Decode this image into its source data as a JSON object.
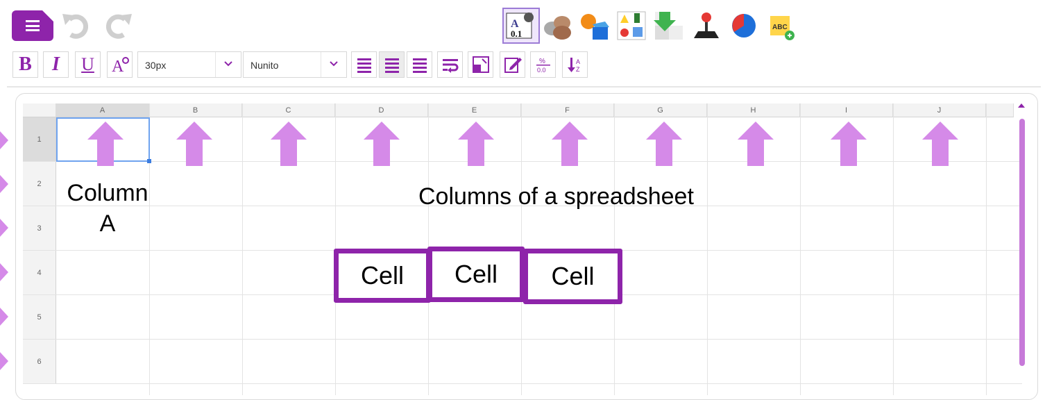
{
  "toolbar": {
    "menu_icon": "hamburger-menu-icon",
    "undo_icon": "undo-icon",
    "redo_icon": "redo-icon",
    "tools": [
      {
        "name": "number-format-tool-icon",
        "selected": true
      },
      {
        "name": "coins-tool-icon"
      },
      {
        "name": "shapes-tool-icon"
      },
      {
        "name": "sorting-chart-tool-icon"
      },
      {
        "name": "download-grid-tool-icon"
      },
      {
        "name": "joystick-tool-icon"
      },
      {
        "name": "pie-chart-tool-icon"
      },
      {
        "name": "add-text-tool-icon"
      }
    ]
  },
  "format_bar": {
    "bold": "B",
    "italic": "I",
    "underline": "U",
    "font_size": "30px",
    "font_family": "Nunito"
  },
  "sheet": {
    "columns": [
      "A",
      "B",
      "C",
      "D",
      "E",
      "F",
      "G",
      "H",
      "I",
      "J"
    ],
    "rows": [
      "1",
      "2",
      "3",
      "4",
      "5",
      "6"
    ],
    "selected_cell": "A1"
  },
  "annotations": {
    "column_a_label_line1": "Column",
    "column_a_label_line2": "A",
    "columns_label": "Columns of a spreadsheet",
    "cell_labels": [
      "Cell",
      "Cell",
      "Cell"
    ]
  },
  "colors": {
    "accent": "#8e24aa",
    "arrow": "#d58ae8",
    "scrollbar": "#c77ad9"
  }
}
